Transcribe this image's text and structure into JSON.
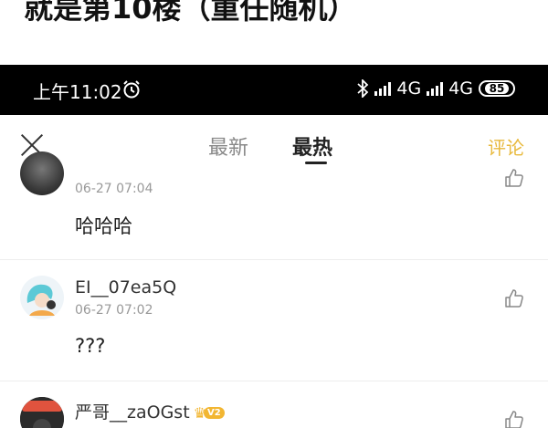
{
  "caption": "就是第10楼（重任随机）",
  "statusbar": {
    "time": "上午11:02",
    "net1": "4G",
    "net2": "4G",
    "battery": "85"
  },
  "topbar": {
    "tab_new": "最新",
    "tab_hot": "最热",
    "comment_label": "评论",
    "active_tab": "最热"
  },
  "comments": [
    {
      "username": "",
      "time": "06-27 07:04",
      "text": "哈哈哈"
    },
    {
      "username": "EI__07ea5Q",
      "time": "06-27 07:02",
      "text": "???"
    },
    {
      "username": "严哥__zaOGst",
      "level": "V2",
      "time": "",
      "text": ""
    }
  ],
  "colors": {
    "accent": "#e8b93c",
    "statusbar": "#000000",
    "muted": "#999999",
    "badge": "#f2b632"
  },
  "icons": [
    "alarm-icon",
    "bluetooth-icon",
    "signal-icon",
    "battery-icon",
    "close-icon",
    "like-icon"
  ]
}
